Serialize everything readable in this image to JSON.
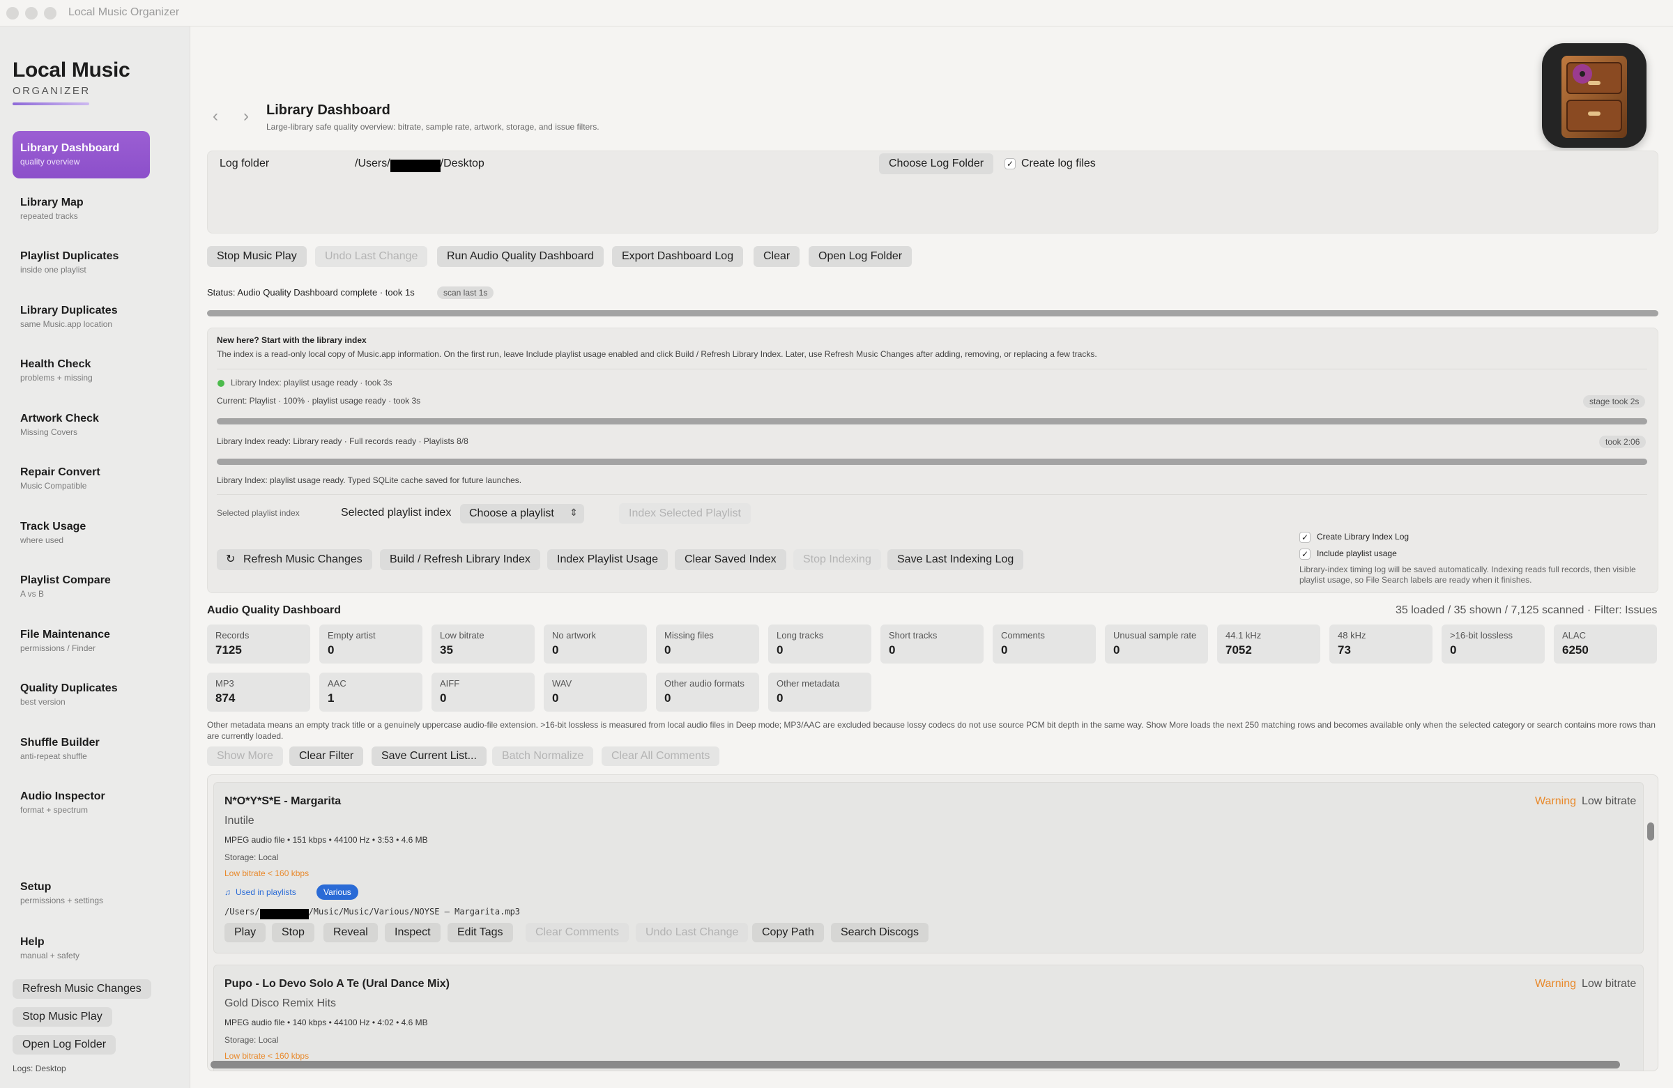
{
  "window": {
    "title": "Local Music Organizer"
  },
  "sidebar": {
    "brand_title": "Local Music",
    "brand_sub": "ORGANIZER",
    "items": [
      {
        "label": "Library Dashboard",
        "sub": "quality overview"
      },
      {
        "label": "Library Map",
        "sub": "repeated tracks"
      },
      {
        "label": "Playlist Duplicates",
        "sub": "inside one playlist"
      },
      {
        "label": "Library Duplicates",
        "sub": "same Music.app location"
      },
      {
        "label": "Health Check",
        "sub": "problems + missing"
      },
      {
        "label": "Artwork Check",
        "sub": "Missing Covers"
      },
      {
        "label": "Repair Convert",
        "sub": "Music Compatible"
      },
      {
        "label": "Track Usage",
        "sub": "where used"
      },
      {
        "label": "Playlist Compare",
        "sub": "A vs B"
      },
      {
        "label": "File Maintenance",
        "sub": "permissions / Finder"
      },
      {
        "label": "Quality Duplicates",
        "sub": "best version"
      },
      {
        "label": "Shuffle Builder",
        "sub": "anti-repeat shuffle"
      },
      {
        "label": "Audio Inspector",
        "sub": "format + spectrum"
      },
      {
        "label": "Setup",
        "sub": "permissions + settings"
      },
      {
        "label": "Help",
        "sub": "manual + safety"
      }
    ],
    "buttons": [
      "Refresh Music Changes",
      "Stop Music Play",
      "Open Log Folder"
    ],
    "logs_label": "Logs: Desktop"
  },
  "header": {
    "back": "‹",
    "forward": "›",
    "title": "Library Dashboard",
    "subtitle": "Large-library safe quality overview: bitrate, sample rate, artwork, storage, and issue filters."
  },
  "log_panel": {
    "label": "Log folder",
    "path_prefix": "/Users/",
    "path_redacted": "xxxxxxxx",
    "path_suffix": "/Desktop",
    "choose_button": "Choose Log Folder",
    "create_logs_label": "Create log files",
    "create_logs_checked": "✓"
  },
  "toolbar": [
    "Stop Music Play",
    "Undo Last Change",
    "Run Audio Quality Dashboard",
    "Export Dashboard Log",
    "Clear",
    "Open Log Folder"
  ],
  "status": {
    "text": "Status: Audio Quality Dashboard complete · took 1s",
    "pill": "scan last 1s"
  },
  "index_panel": {
    "heading": "New here? Start with the library index",
    "description": "The index is a read-only local copy of Music.app information. On the first run, leave Include playlist usage enabled and click Build / Refresh Library Index. Later, use Refresh Music Changes after adding, removing, or replacing a few tracks.",
    "status_line": "Library Index: playlist usage ready · took 3s",
    "current_line": "Current: Playlist · 100% · playlist usage ready · took 3s",
    "current_pill": "stage took 2s",
    "ready_line": "Library Index ready: Library ready · Full records ready · Playlists 8/8",
    "ready_pill": "took 2:06",
    "cache_line": "Library Index: playlist usage ready. Typed SQLite cache saved for future launches.",
    "selected_small": "Selected playlist index",
    "selected_label": "Selected playlist index",
    "select_value": "Choose a playlist",
    "index_selected_button": "Index Selected Playlist",
    "buttons": [
      "Refresh Music Changes",
      "Build / Refresh Library Index",
      "Index Playlist Usage",
      "Clear Saved Index",
      "Stop Indexing",
      "Save Last Indexing Log"
    ],
    "create_index_log": "Create Library Index Log",
    "include_playlist_usage": "Include playlist usage",
    "note": "Library-index timing log will be saved automatically. Indexing reads full records, then visible playlist usage, so File Search labels are ready when it finishes."
  },
  "dashboard": {
    "title": "Audio Quality Dashboard",
    "summary": "35 loaded / 35 shown / 7,125 scanned · Filter: Issues",
    "stats_row1": [
      {
        "label": "Records",
        "value": "7125"
      },
      {
        "label": "Empty artist",
        "value": "0"
      },
      {
        "label": "Low bitrate",
        "value": "35"
      },
      {
        "label": "No artwork",
        "value": "0"
      },
      {
        "label": "Missing files",
        "value": "0"
      },
      {
        "label": "Long tracks",
        "value": "0"
      },
      {
        "label": "Short tracks",
        "value": "0"
      },
      {
        "label": "Comments",
        "value": "0"
      },
      {
        "label": "Unusual sample rate",
        "value": "0"
      },
      {
        "label": "44.1 kHz",
        "value": "7052"
      },
      {
        "label": "48 kHz",
        "value": "73"
      },
      {
        "label": ">16-bit lossless",
        "value": "0"
      },
      {
        "label": "ALAC",
        "value": "6250"
      }
    ],
    "stats_row2": [
      {
        "label": "MP3",
        "value": "874"
      },
      {
        "label": "AAC",
        "value": "1"
      },
      {
        "label": "AIFF",
        "value": "0"
      },
      {
        "label": "WAV",
        "value": "0"
      },
      {
        "label": "Other audio formats",
        "value": "0"
      },
      {
        "label": "Other metadata",
        "value": "0"
      }
    ],
    "note": "Other metadata means an empty track title or a genuinely uppercase audio-file extension. >16-bit lossless is measured from local audio files in Deep mode; MP3/AAC are excluded because lossy codecs do not use source PCM bit depth in the same way. Show More loads the next 250 matching rows and becomes available only when the selected category or search contains more rows than are currently loaded.",
    "actions": [
      "Show More",
      "Clear Filter",
      "Save Current List...",
      "Batch Normalize",
      "Clear All Comments"
    ]
  },
  "tracks": [
    {
      "title": "N*O*Y*S*E - Margarita",
      "album": "Inutile",
      "details": "MPEG audio file • 151 kbps • 44100 Hz • 3:53 • 4.6 MB",
      "storage": "Storage: Local",
      "issue": "Low bitrate < 160 kbps",
      "used_in": "Used in playlists",
      "playlist_tag": "Various",
      "path_prefix": "/Users/",
      "path_redacted": "xxxxxxxx",
      "path_suffix": "/Music/Music/Various/NOYSE – Margarita.mp3",
      "warning": "Warning",
      "warning_type": "Low bitrate",
      "buttons": [
        "Play",
        "Stop",
        "Reveal",
        "Inspect",
        "Edit Tags",
        "Clear Comments",
        "Undo Last Change",
        "Copy Path",
        "Search Discogs"
      ]
    },
    {
      "title": "Pupo - Lo Devo Solo A Te (Ural Dance Mix)",
      "album": "Gold Disco Remix Hits",
      "details": "MPEG audio file • 140 kbps • 44100 Hz • 4:02 • 4.6 MB",
      "storage": "Storage: Local",
      "issue": "Low bitrate < 160 kbps",
      "warning": "Warning",
      "warning_type": "Low bitrate"
    }
  ]
}
